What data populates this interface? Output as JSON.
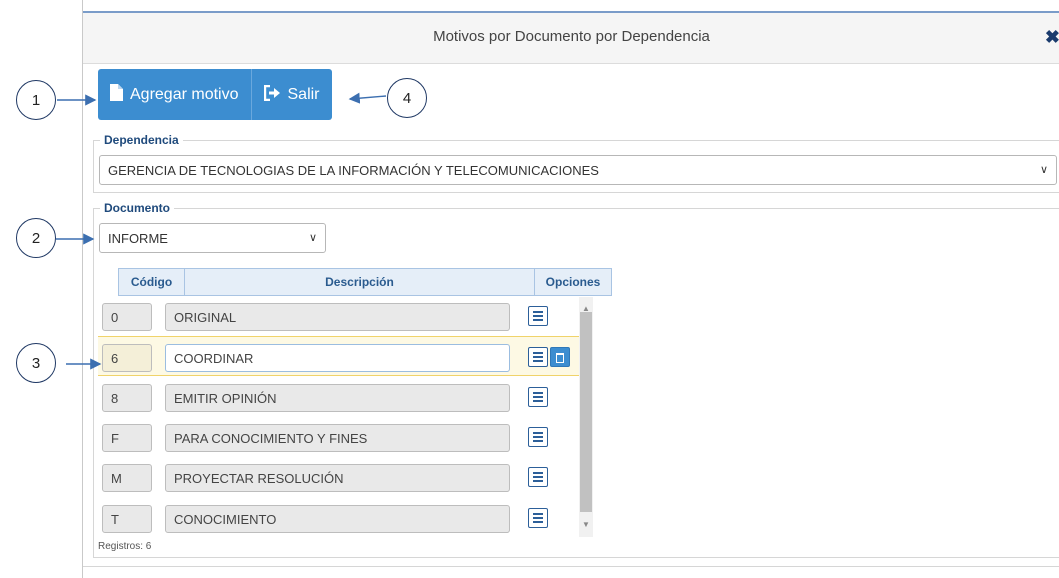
{
  "dialog": {
    "title": "Motivos por Documento por Dependencia",
    "close_symbol": "✖"
  },
  "toolbar": {
    "add_label": "Agregar motivo",
    "exit_label": "Salir"
  },
  "dependencia": {
    "legend": "Dependencia",
    "value": "GERENCIA DE TECNOLOGIAS DE LA INFORMACIÓN Y TELECOMUNICACIONES"
  },
  "documento": {
    "legend": "Documento",
    "value": "INFORME"
  },
  "grid": {
    "headers": {
      "code": "Código",
      "description": "Descripción",
      "options": "Opciones"
    },
    "rows": [
      {
        "code": "0",
        "description": "ORIGINAL"
      },
      {
        "code": "6",
        "description": "COORDINAR"
      },
      {
        "code": "8",
        "description": "EMITIR OPINIÓN"
      },
      {
        "code": "F",
        "description": "PARA CONOCIMIENTO Y FINES"
      },
      {
        "code": "M",
        "description": "PROYECTAR RESOLUCIÓN"
      },
      {
        "code": "T",
        "description": "CONOCIMIENTO"
      }
    ],
    "records_label": "Registros: 6",
    "selected_row": 1
  },
  "annotations": [
    "1",
    "2",
    "3",
    "4"
  ],
  "colors": {
    "primary": "#3c8dd0",
    "selected_row": "#fdf9e4",
    "header_border": "#7a9cc9"
  }
}
